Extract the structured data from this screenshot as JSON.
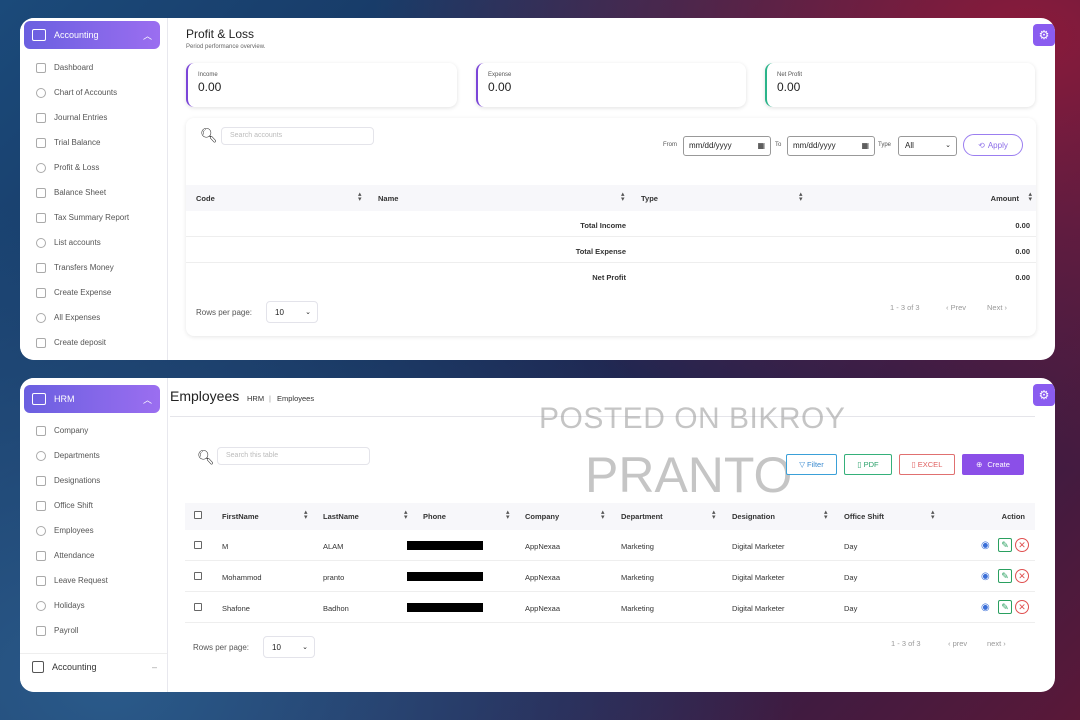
{
  "top": {
    "sidebar": {
      "header": "Accounting",
      "items": [
        {
          "label": "Dashboard",
          "icon": "chart-line-icon"
        },
        {
          "label": "Chart of Accounts",
          "icon": "ledger-icon"
        },
        {
          "label": "Journal Entries",
          "icon": "journal-icon"
        },
        {
          "label": "Trial Balance",
          "icon": "chart-icon"
        },
        {
          "label": "Profit & Loss",
          "icon": "scale-icon"
        },
        {
          "label": "Balance Sheet",
          "icon": "balance-icon"
        },
        {
          "label": "Tax Summary Report",
          "icon": "report-icon"
        },
        {
          "label": "List accounts",
          "icon": "list-icon"
        },
        {
          "label": "Transfers Money",
          "icon": "transfer-icon"
        },
        {
          "label": "Create Expense",
          "icon": "expense-icon"
        },
        {
          "label": "All Expenses",
          "icon": "expenses-icon"
        },
        {
          "label": "Create deposit",
          "icon": "deposit-icon"
        }
      ]
    },
    "title": "Profit & Loss",
    "subtitle": "Period performance overview.",
    "cards": {
      "income": {
        "label": "Income",
        "value": "0.00"
      },
      "expense": {
        "label": "Expense",
        "value": "0.00"
      },
      "net": {
        "label": "Net Profit",
        "value": "0.00"
      }
    },
    "search_placeholder": "Search accounts",
    "filters": {
      "from_label": "From",
      "from_value": "mm/dd/yyyy",
      "to_label": "To",
      "to_value": "mm/dd/yyyy",
      "type_label": "Type",
      "type_value": "All",
      "apply_label": "Apply"
    },
    "columns": [
      "Code",
      "Name",
      "Type",
      "Amount"
    ],
    "rows": [
      {
        "label": "Total Income",
        "amount": "0.00"
      },
      {
        "label": "Total Expense",
        "amount": "0.00"
      },
      {
        "label": "Net Profit",
        "amount": "0.00"
      }
    ],
    "rows_per_page_label": "Rows per page:",
    "rows_per_page": "10",
    "pagination": {
      "range": "1 - 3 of 3",
      "prev": "Prev",
      "next": "Next"
    }
  },
  "bottom": {
    "sidebar": {
      "header": "HRM",
      "items": [
        {
          "label": "Company",
          "icon": "company-icon"
        },
        {
          "label": "Departments",
          "icon": "departments-icon"
        },
        {
          "label": "Designations",
          "icon": "designations-icon"
        },
        {
          "label": "Office Shift",
          "icon": "shift-icon"
        },
        {
          "label": "Employees",
          "icon": "employees-icon"
        },
        {
          "label": "Attendance",
          "icon": "attendance-icon"
        },
        {
          "label": "Leave Request",
          "icon": "leave-icon"
        },
        {
          "label": "Holidays",
          "icon": "holidays-icon"
        },
        {
          "label": "Payroll",
          "icon": "payroll-icon"
        }
      ],
      "footer": "Accounting"
    },
    "title": "Employees",
    "breadcrumb": [
      "HRM",
      "Employees"
    ],
    "watermark": {
      "line1": "POSTED ON BIKROY",
      "line2": "PRANTO"
    },
    "search_placeholder": "Search this table",
    "buttons": {
      "filter": "Filter",
      "pdf": "PDF",
      "excel": "EXCEL",
      "create": "Create"
    },
    "columns": [
      "FirstName",
      "LastName",
      "Phone",
      "Company",
      "Department",
      "Designation",
      "Office Shift",
      "Action"
    ],
    "rows": [
      {
        "first": "M",
        "last": "ALAM",
        "company": "AppNexaa",
        "department": "Marketing",
        "designation": "Digital Marketer",
        "shift": "Day"
      },
      {
        "first": "Mohammod",
        "last": "pranto",
        "company": "AppNexaa",
        "department": "Marketing",
        "designation": "Digital Marketer",
        "shift": "Day"
      },
      {
        "first": "Shafone",
        "last": "Badhon",
        "company": "AppNexaa",
        "department": "Marketing",
        "designation": "Digital Marketer",
        "shift": "Day"
      }
    ],
    "rows_per_page_label": "Rows per page:",
    "rows_per_page": "10",
    "pagination": {
      "range": "1 - 3 of 3",
      "prev": "prev",
      "next": "next"
    }
  },
  "colors": {
    "accent": "#8b4fe8",
    "net_profit_border": "#2bb48a"
  }
}
